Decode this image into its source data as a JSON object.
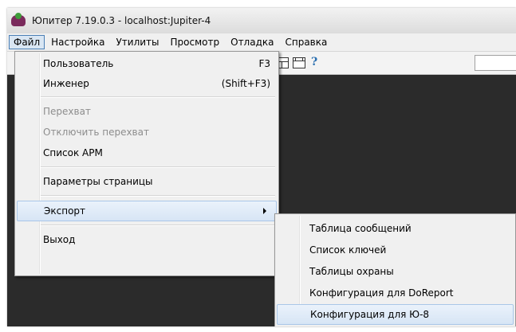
{
  "window": {
    "title": "Юпитер 7.19.0.3  -  localhost:Jupiter-4"
  },
  "menubar": {
    "items": [
      {
        "label": "Файл",
        "active": true
      },
      {
        "label": "Настройка"
      },
      {
        "label": "Утилиты"
      },
      {
        "label": "Просмотр"
      },
      {
        "label": "Отладка"
      },
      {
        "label": "Справка"
      }
    ]
  },
  "toolbar": {
    "help_glyph": "?"
  },
  "file_menu": {
    "items": [
      {
        "label": "Пользователь",
        "shortcut": "F3",
        "enabled": true
      },
      {
        "label": "Инженер",
        "shortcut": "(Shift+F3)",
        "enabled": true
      },
      {
        "label": "Перехват",
        "shortcut": "",
        "enabled": false
      },
      {
        "label": "Отключить перехват",
        "shortcut": "",
        "enabled": false
      },
      {
        "label": "Список АРМ",
        "shortcut": "",
        "enabled": true
      },
      {
        "label": "Параметры страницы",
        "shortcut": "",
        "enabled": true
      },
      {
        "label": "Экспорт",
        "shortcut": "",
        "enabled": true,
        "submenu": true,
        "highlighted": true
      },
      {
        "label": "Выход",
        "shortcut": "",
        "enabled": true
      }
    ]
  },
  "export_submenu": {
    "items": [
      {
        "label": "Таблица сообщений"
      },
      {
        "label": "Список ключей"
      },
      {
        "label": "Таблицы охраны"
      },
      {
        "label": "Конфигурация для DoReport"
      },
      {
        "label": "Конфигурация для Ю-8",
        "highlighted": true
      }
    ]
  },
  "colors": {
    "workspace": "#2b2b2b",
    "menu_bg": "#f0f0f0",
    "highlight": "#d7e5f5",
    "active_menu_border": "#4a7fb5"
  }
}
